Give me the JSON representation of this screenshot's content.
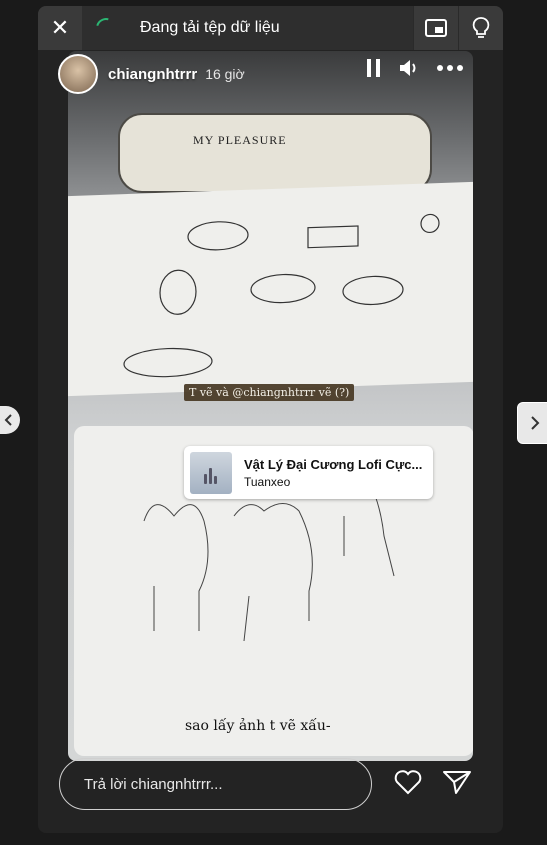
{
  "top_bar": {
    "loading_text": "Đang tải tệp dữ liệu"
  },
  "story": {
    "username": "chiangnhtrrr",
    "time_ago": "16 giờ",
    "overlay_text": "T vẽ và @chiangnhtrrr vẽ (?)",
    "music": {
      "title": "Vật Lý Đại Cương Lofi Cực...",
      "artist": "Tuanxeo"
    },
    "caption": "sao lấy ảnh t vẽ xấu-",
    "pouch_text": "MY PLEASURE"
  },
  "reply": {
    "placeholder": "Trả lời chiangnhtrrr..."
  },
  "colors": {
    "spinner": "#2bb673",
    "panel": "#232323"
  }
}
